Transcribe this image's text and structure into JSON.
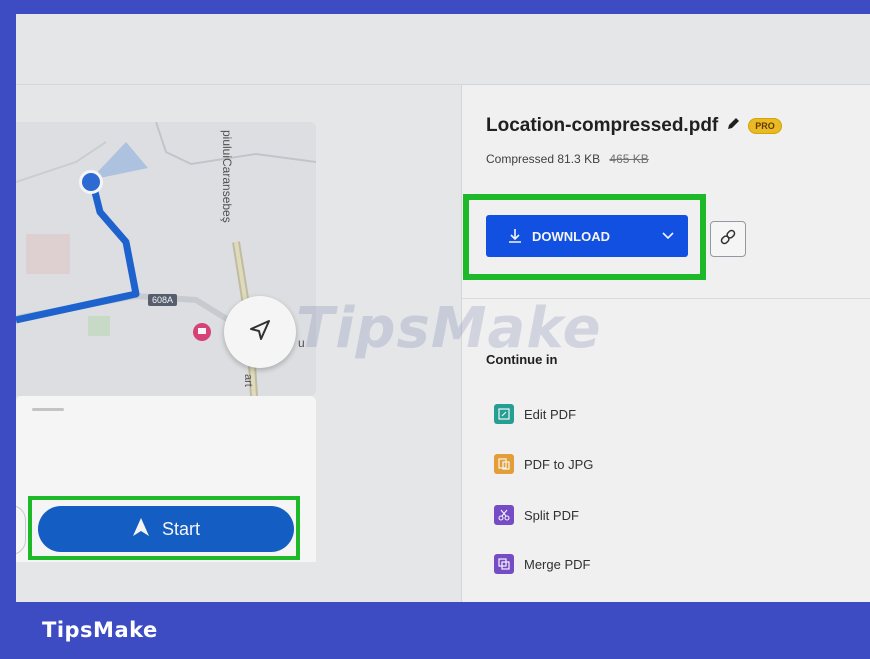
{
  "brand": "TipsMake",
  "watermark": "TipsMake",
  "map": {
    "street_label": "piuluiCaransebeş",
    "road_badge": "608A",
    "partial_label_right": "u",
    "partial_label_bottom": "art"
  },
  "nav": {
    "start_label": "Start"
  },
  "file": {
    "name": "Location-compressed.pdf",
    "badge": "PRO",
    "compressed_label": "Compressed",
    "compressed_size": "81.3 KB",
    "original_size": "465 KB"
  },
  "actions": {
    "download_label": "DOWNLOAD"
  },
  "continue": {
    "heading": "Continue in",
    "tools": [
      {
        "label": "Edit PDF",
        "color": "#27a59b"
      },
      {
        "label": "PDF to JPG",
        "color": "#eda53a"
      },
      {
        "label": "Split PDF",
        "color": "#7a4fcf"
      },
      {
        "label": "Merge PDF",
        "color": "#7a4fcf"
      }
    ]
  },
  "colors": {
    "frame": "#3d4cc3",
    "highlight": "#1fc12a",
    "download_button": "#1254ea",
    "start_button": "#1561cb"
  }
}
